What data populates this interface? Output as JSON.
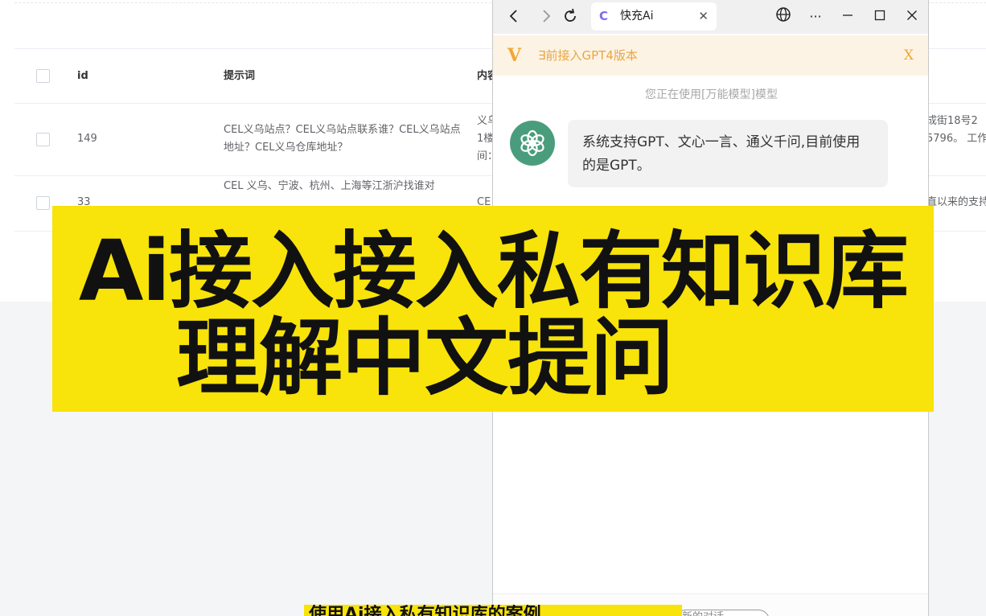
{
  "table": {
    "headers": {
      "id": "id",
      "prompt": "提示词",
      "content": "内容"
    },
    "rows": [
      {
        "id": "149",
        "prompt": "CEL义乌站点？CEL义乌站点联系谁？CEL义乌站点地址？CEL义乌仓库地址？",
        "content_lines": [
          "义乌",
          "1楼",
          "间："
        ],
        "right_lines": [
          "成街18号2",
          "5796。 工作"
        ]
      },
      {
        "id": "33",
        "prompt": "CEL 义乌、宁波、杭州、上海等江浙沪找谁对",
        "content_lines": [
          "CE"
        ],
        "right_lines": [
          "直以来的支持"
        ]
      }
    ]
  },
  "browser": {
    "tab_title": "快充Ai",
    "notice_text": "∃前接入GPT4版本",
    "notice_close": "X",
    "model_line": "您正在使用[万能模型]模型",
    "message": "系统支持GPT、文心一言、通义千问,目前使用的是GPT。",
    "new_chat_label": "新的对话"
  },
  "overlay": {
    "line1": "Ai接入接入私有知识库",
    "line2": "理解中文提问",
    "sub_caption": "使用Ai接入私有知识库的案例"
  },
  "colors": {
    "banner": "#f8e30a",
    "notice_bg": "#fdf3e4",
    "notice_text": "#e8a643",
    "avatar": "#4a9d7c"
  },
  "icons": {
    "back": "arrow-left-icon",
    "forward": "arrow-right-icon",
    "reload": "reload-icon",
    "globe": "globe-icon",
    "more": "more-icon",
    "minimize": "minimize-icon",
    "maximize": "maximize-icon",
    "close": "close-icon"
  }
}
